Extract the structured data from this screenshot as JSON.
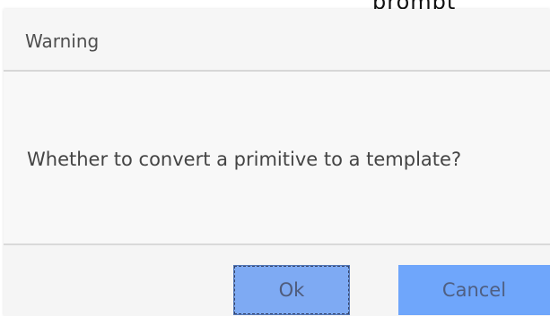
{
  "top_fragment": "prompt",
  "dialog": {
    "title": "Warning",
    "message": "Whether to convert a primitive to a template?",
    "buttons": {
      "ok": "Ok",
      "cancel": "Cancel"
    }
  },
  "colors": {
    "dialog_background": "#f7f7f7",
    "separator": "#d7d7d7",
    "ok_button": "#7eaaf3",
    "cancel_button": "#6fa6fb",
    "button_text": "#4f5b7a"
  }
}
